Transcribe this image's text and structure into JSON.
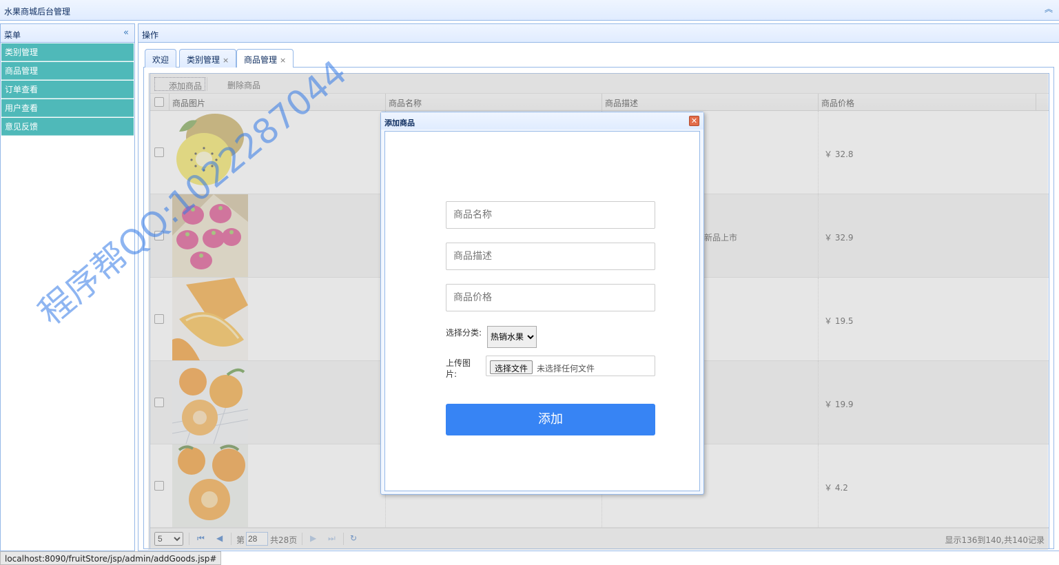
{
  "header": {
    "title": "水果商城后台管理"
  },
  "west": {
    "title": "菜单",
    "menu": [
      {
        "label": "类别管理"
      },
      {
        "label": "商品管理"
      },
      {
        "label": "订单查看"
      },
      {
        "label": "用户查看"
      },
      {
        "label": "意见反馈"
      }
    ]
  },
  "center": {
    "title": "操作",
    "tabs": [
      {
        "label": "欢迎",
        "closable": false
      },
      {
        "label": "类别管理",
        "closable": true
      },
      {
        "label": "商品管理",
        "closable": true,
        "active": true
      }
    ],
    "close_glyph": "×"
  },
  "toolbar": {
    "add_label": "添加商品",
    "delete_label": "删除商品"
  },
  "grid": {
    "columns": [
      "商品图片",
      "商品名称",
      "商品描述",
      "商品价格"
    ],
    "rows": [
      {
        "image": "kiwi",
        "price": "￥ 32.8",
        "desc": ""
      },
      {
        "image": "dragon-fruit",
        "price": "￥ 32.9",
        "desc": "新品上市"
      },
      {
        "image": "orange",
        "price": "￥ 19.5",
        "desc": ""
      },
      {
        "image": "mandarin",
        "price": "￥ 19.9",
        "desc": ""
      },
      {
        "image": "ugli-orange",
        "price": "￥ 4.2",
        "desc": ""
      }
    ]
  },
  "pager": {
    "page_size": "5",
    "page_prefix": "第",
    "current_page": "28",
    "total_pages": "共28页",
    "summary": "显示136到140,共140记录"
  },
  "dialog": {
    "title": "添加商品",
    "name_placeholder": "商品名称",
    "desc_placeholder": "商品描述",
    "price_placeholder": "商品价格",
    "category_label": "选择分类:",
    "category_value": "热销水果",
    "upload_label_1": "上传图",
    "upload_label_2": "片:",
    "file_button": "选择文件",
    "file_status": "未选择任何文件",
    "submit_label": "添加"
  },
  "watermark": "程序帮QQ:1022287044",
  "statusbar": {
    "url": "localhost:8090/fruitStore/jsp/admin/addGoods.jsp#"
  },
  "colors": {
    "menu_bg": "#4fb9b9",
    "panel_border": "#95b8e7",
    "submit_bg": "#3784f4"
  }
}
